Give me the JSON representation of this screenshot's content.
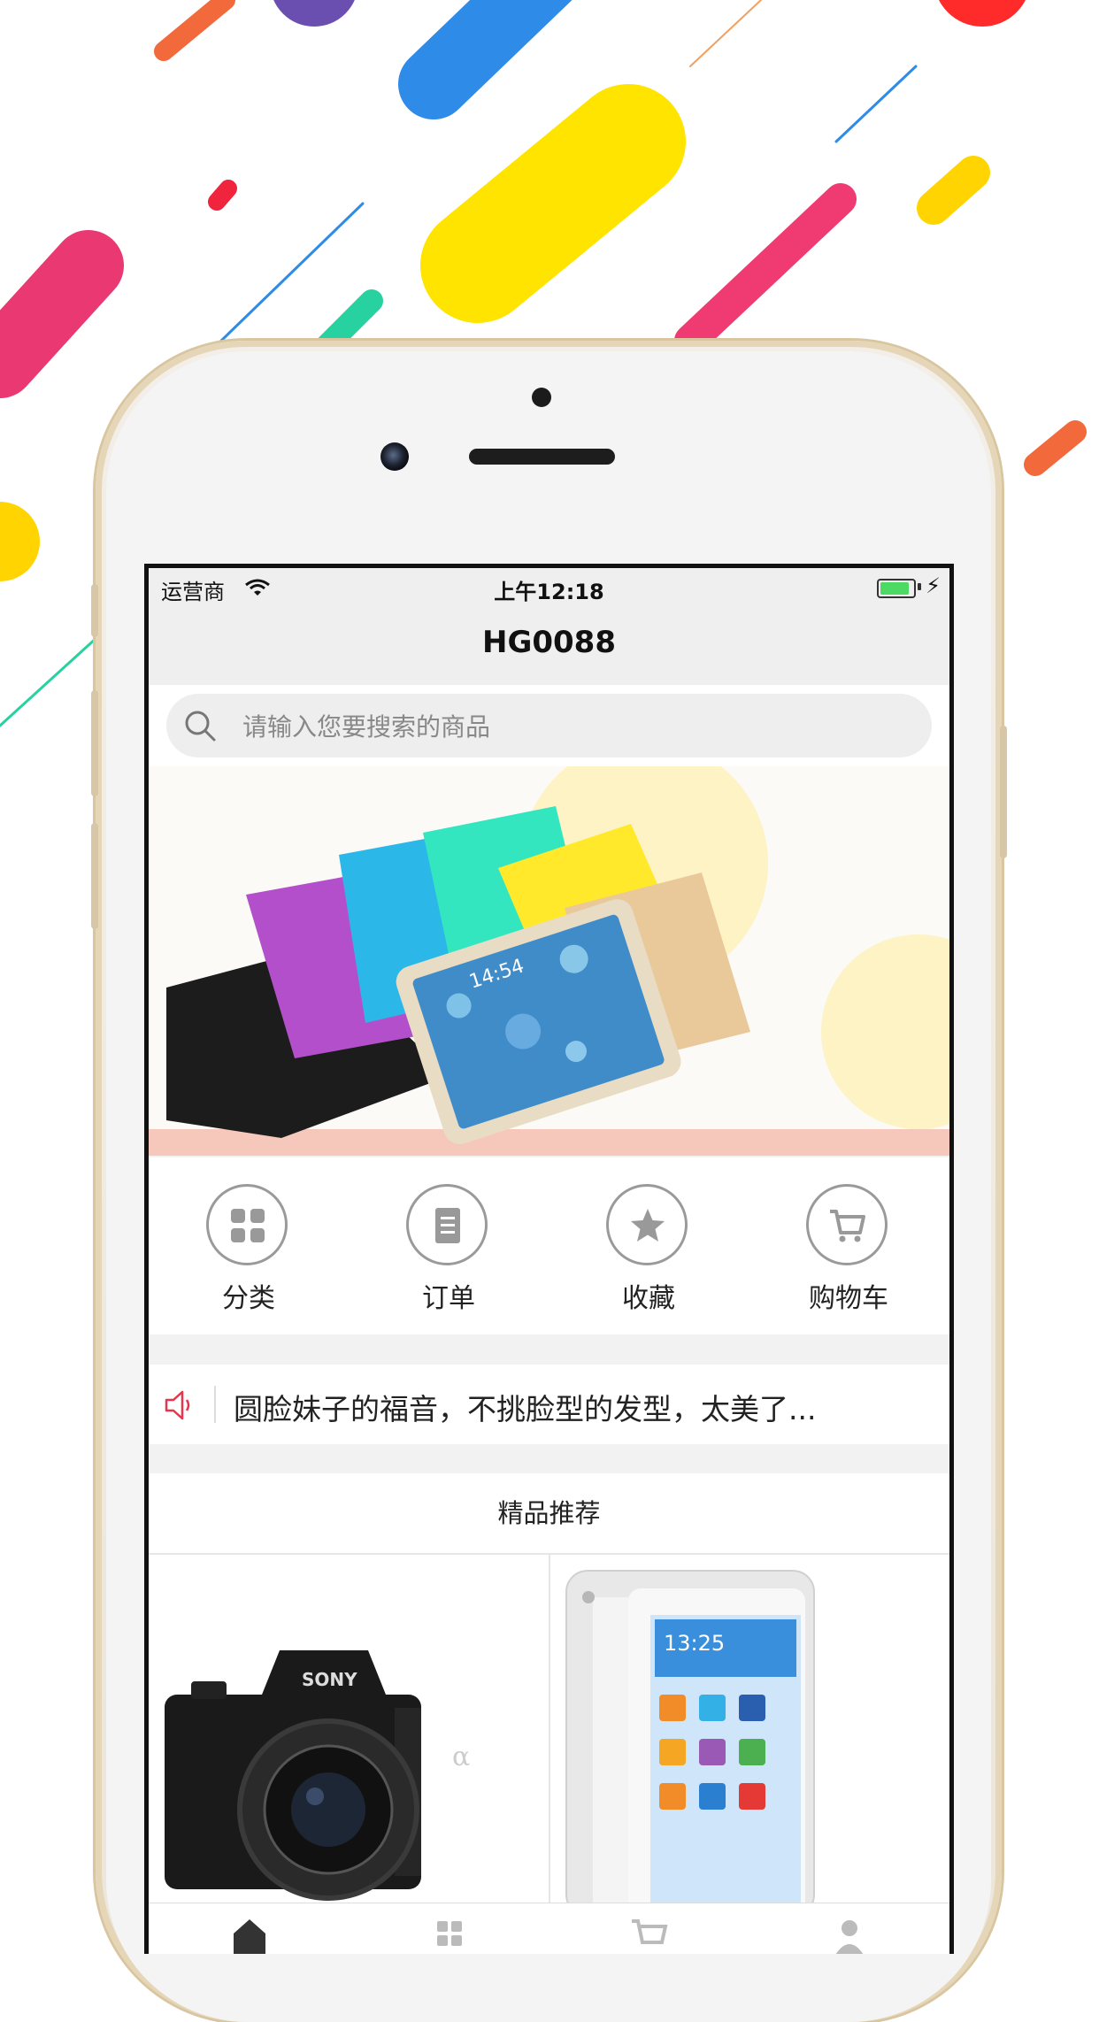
{
  "status_bar": {
    "carrier": "运营商",
    "time": "上午12:18"
  },
  "nav": {
    "title": "HG0088"
  },
  "search": {
    "placeholder": "请输入您要搜索的商品"
  },
  "menu": {
    "items": [
      {
        "label": "分类",
        "icon": "grid-icon"
      },
      {
        "label": "订单",
        "icon": "document-icon"
      },
      {
        "label": "收藏",
        "icon": "star-icon"
      },
      {
        "label": "购物车",
        "icon": "cart-icon"
      }
    ]
  },
  "notice": {
    "icon": "speaker-icon",
    "text": "圆脸妹子的福音，不挑脸型的发型，太美了..."
  },
  "recommend": {
    "title": "精品推荐",
    "camera_brand": "SONY",
    "tablet_clock": "13:25",
    "banner_clock": "14:54"
  },
  "tabbar": {
    "items": [
      {
        "icon": "home-icon"
      },
      {
        "icon": "category-icon"
      },
      {
        "icon": "cart-icon"
      },
      {
        "icon": "user-icon"
      }
    ]
  },
  "colors": {
    "accent_red": "#e8344e",
    "battery_green": "#4cd964",
    "icon_gray": "#9a9a9a"
  }
}
